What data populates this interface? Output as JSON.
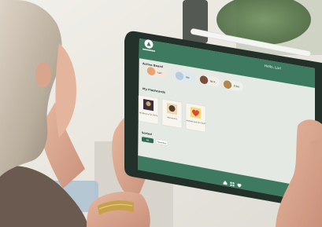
{
  "app": {
    "greeting": "Hello, Lori"
  },
  "sections": {
    "active_board": "Active Board",
    "my_flashcards": "My Flashcards",
    "sorted": "Sorted"
  },
  "active_board": [
    {
      "label": "Lori",
      "avatar": "person"
    },
    {
      "label": "Mo",
      "avatar": "bubble"
    },
    {
      "label": "Nick",
      "avatar": "person"
    },
    {
      "label": "Elise",
      "avatar": "person"
    }
  ],
  "flashcards": [
    {
      "label": "All About a Fun Story",
      "icon": "dog-icon",
      "color": "#3b2f3a"
    },
    {
      "label": "Adventures",
      "icon": "dog-icon",
      "color": "#5a3b2a"
    },
    {
      "label": "Animals and Fun Stuff",
      "icon": "heart-icon",
      "color": "#d9483b"
    }
  ],
  "sort_buttons": [
    {
      "label": "All",
      "active": true
    },
    {
      "label": "Favorites",
      "active": false
    }
  ],
  "bottom_nav": [
    "home-icon",
    "grid-icon",
    "heart-icon"
  ],
  "colors": {
    "accent": "#2f6b54",
    "screen_bg": "#e4e9e3",
    "header_bg": "#3d7a60",
    "card_bg": "#f7f5ee"
  }
}
